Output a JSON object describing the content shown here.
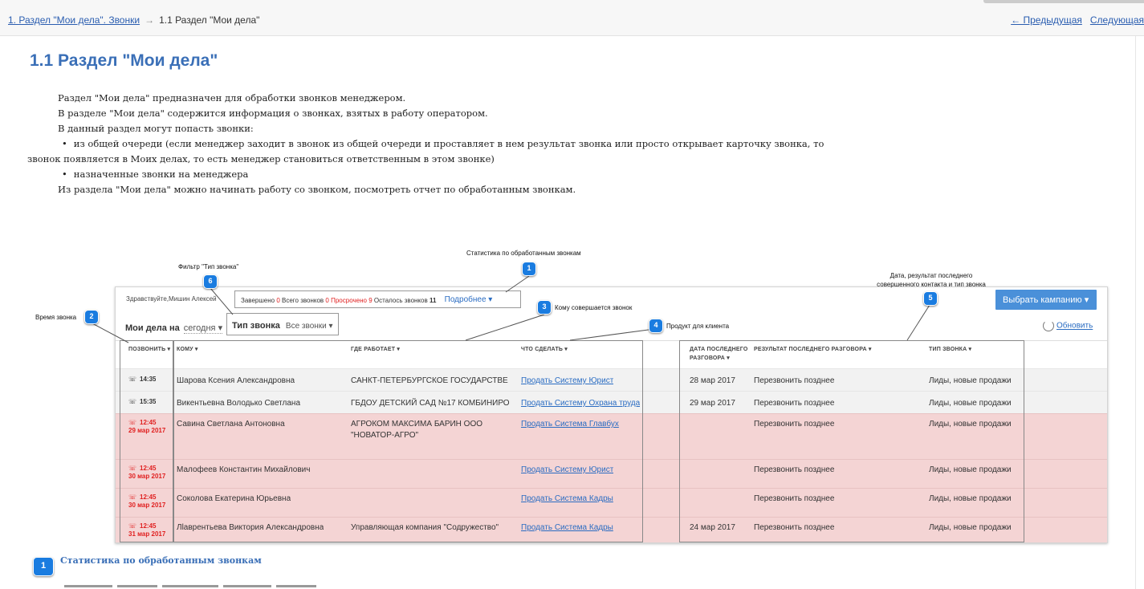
{
  "nav": {
    "breadcrumb_link": "1. Раздел \"Мои дела\". Звонки",
    "breadcrumb_arrow": "→",
    "breadcrumb_current": "1.1 Раздел \"Мои дела\"",
    "prev": "← Предыдущая",
    "next": "Следующая"
  },
  "heading": "1.1 Раздел \"Мои дела\"",
  "intro": {
    "p1": "Раздел \"Мои дела\" предназначен для обработки звонков менеджером.",
    "p2": "В разделе \"Мои дела\" содержится информация о звонках, взятых в работу оператором.",
    "p3": "В данный раздел могут попасть звонки:",
    "li1a": "из общей очереди (если менеджер заходит в звонок из общей очереди и проставляет в нем результат звонка или просто открывает карточку звонка, то",
    "li1b": "звонок появляется в Моих делах, то есть менеджер становиться ответственным в этом звонке)",
    "li2": "назначенные звонки на менеджера",
    "p4": "Из раздела \"Мои дела\" можно начинать работу со звонком, посмотреть отчет по обработанным звонкам."
  },
  "app": {
    "greeting": "Здравствуйте,Мишин Алексей",
    "stats": {
      "done_label": "Завершено",
      "done": "0",
      "total_label": "Всего звонков",
      "total": "0",
      "overdue_label": "Просрочено",
      "overdue": "9",
      "left_label": "Осталось звонков",
      "left": "11",
      "more": "Подробнее ▾"
    },
    "campaign_button": "Выбрать кампанию  ▾",
    "mydela_label": "Мои дела на",
    "mydela_value": "сегодня ▾",
    "type_label": "Тип звонка",
    "type_value": "Все звонки ▾",
    "refresh": "Обновить",
    "columns": {
      "call": "ПОЗВОНИТЬ ▾",
      "whom": "КОМУ ▾",
      "work": "ГДЕ РАБОТАЕТ ▾",
      "todo": "ЧТО СДЕЛАТЬ ▾",
      "date1": "ДАТА ПОСЛЕДНЕГО",
      "date2": "РАЗГОВОРА ▾",
      "result": "РЕЗУЛЬТАТ ПОСЛЕДНЕГО РАЗГОВОРА ▾",
      "type": "ТИП ЗВОНКА ▾"
    },
    "rows": [
      {
        "time": "14:35",
        "tdate": "",
        "name": "Шарова Ксения Александровна",
        "work": "САНКТ-ПЕТЕРБУРГСКОЕ ГОСУДАРСТВЕ",
        "todo": "Продать Систему Юрист",
        "date": "28 мар 2017",
        "result": "Перезвонить позднее",
        "type": "Лиды, новые продажи"
      },
      {
        "time": "15:35",
        "tdate": "",
        "name": "Викентьевна Володько Светлана",
        "work": "ГБДОУ ДЕТСКИЙ САД №17 КОМБИНИРО",
        "todo": "Продать Систему Охрана труда",
        "date": "29 мар 2017",
        "result": "Перезвонить позднее",
        "type": "Лиды, новые продажи"
      },
      {
        "time": "12:45",
        "tdate": "29 мар 2017",
        "name": "Савина Светлана Антоновна",
        "work": "АГРОКОМ МАКСИМА БАРИН ООО \"НОВАТОР-АГРО\"",
        "todo": "Продать Система Главбух",
        "date": "",
        "result": "Перезвонить позднее",
        "type": "Лиды, новые продажи"
      },
      {
        "time": "12:45",
        "tdate": "30 мар 2017",
        "name": "Малофеев Константин Михайлович",
        "work": "",
        "todo": "Продать Систему Юрист",
        "date": "",
        "result": "Перезвонить позднее",
        "type": "Лиды, новые продажи"
      },
      {
        "time": "12:45",
        "tdate": "30 мар 2017",
        "name": "Соколова Екатерина Юрьевна",
        "work": "",
        "todo": "Продать Система Кадры",
        "date": "",
        "result": "Перезвонить позднее",
        "type": "Лиды, новые продажи"
      },
      {
        "time": "12:45",
        "tdate": "31 мар 2017",
        "name": "Лlавpентьева Виктория Александровна",
        "work": "Управляющая компания \"Содружество\"",
        "todo": "Продать Система Кадры",
        "date": "24 мар 2017",
        "result": "Перезвонить позднее",
        "type": "Лиды, новые продажи"
      }
    ]
  },
  "annotations": {
    "a1": "Статистика по обработанным звонкам",
    "a2": "Время звонка",
    "a3": "Кому совершается звонок",
    "a4": "Продукт для клиента",
    "a5a": "Дата, результат последнего",
    "a5b": "совершенного контакта и тип звонка",
    "a6": "Фильтр \"Тип звонка\""
  },
  "badges": {
    "b1": "1",
    "b2": "2",
    "b3": "3",
    "b4": "4",
    "b5": "5",
    "b6": "6",
    "sec": "1"
  },
  "section2_title": "Статистика по обработанным звонкам",
  "colors": {
    "accent": "#3a6fb7",
    "badge": "#1a7ce0",
    "overdue_row": "#f4d4d4",
    "overdue_text": "#e02020",
    "campaign": "#4a90d9"
  }
}
